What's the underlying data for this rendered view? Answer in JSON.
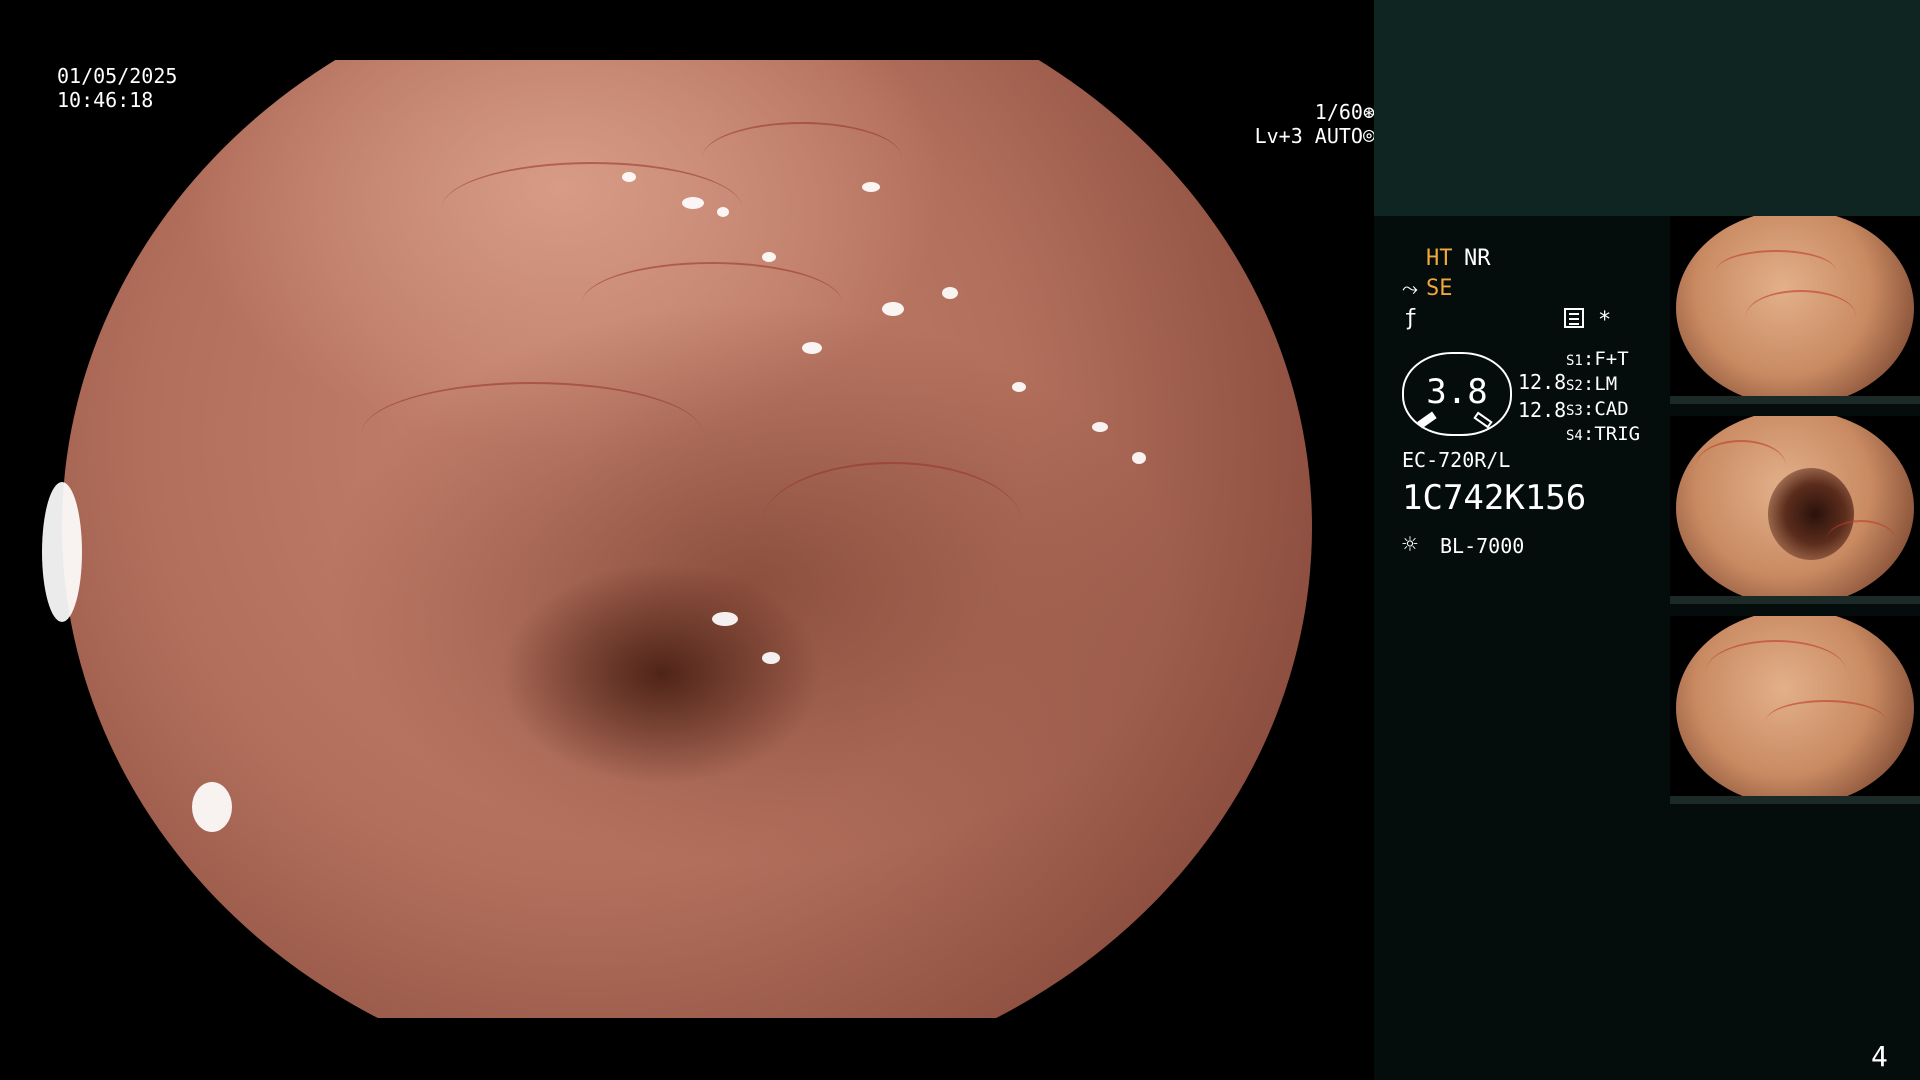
{
  "video_overlay": {
    "date": "01/05/2025",
    "time": "10:46:18",
    "shutter": "1/60",
    "shutter_icon": "aperture-icon",
    "level": "Lv+3 AUTO",
    "auto_icon": "iris-icon"
  },
  "modes": {
    "ht": "HT",
    "nr": "NR",
    "se": "SE",
    "se_icon": "curve-icon",
    "fn_icon": "f-slash-icon",
    "menu_icon": "menu-icon",
    "asterisk": "*"
  },
  "gauge": {
    "value": "3.8",
    "readout_1": "12.8",
    "readout_2": "12.8"
  },
  "switches": [
    {
      "key": "S1",
      "label": "F+T"
    },
    {
      "key": "S2",
      "label": "LM"
    },
    {
      "key": "S3",
      "label": "CAD"
    },
    {
      "key": "S4",
      "label": "TRIG"
    }
  ],
  "scope": {
    "model": "EC-720R/L",
    "serial": "1C742K156"
  },
  "light": {
    "icon": "sun-icon",
    "source": "BL-7000"
  },
  "colors": {
    "panel_top": "#0f2521",
    "panel_bottom": "#040d0b",
    "accent_orange": "#f0a83a"
  },
  "page_number": "4"
}
